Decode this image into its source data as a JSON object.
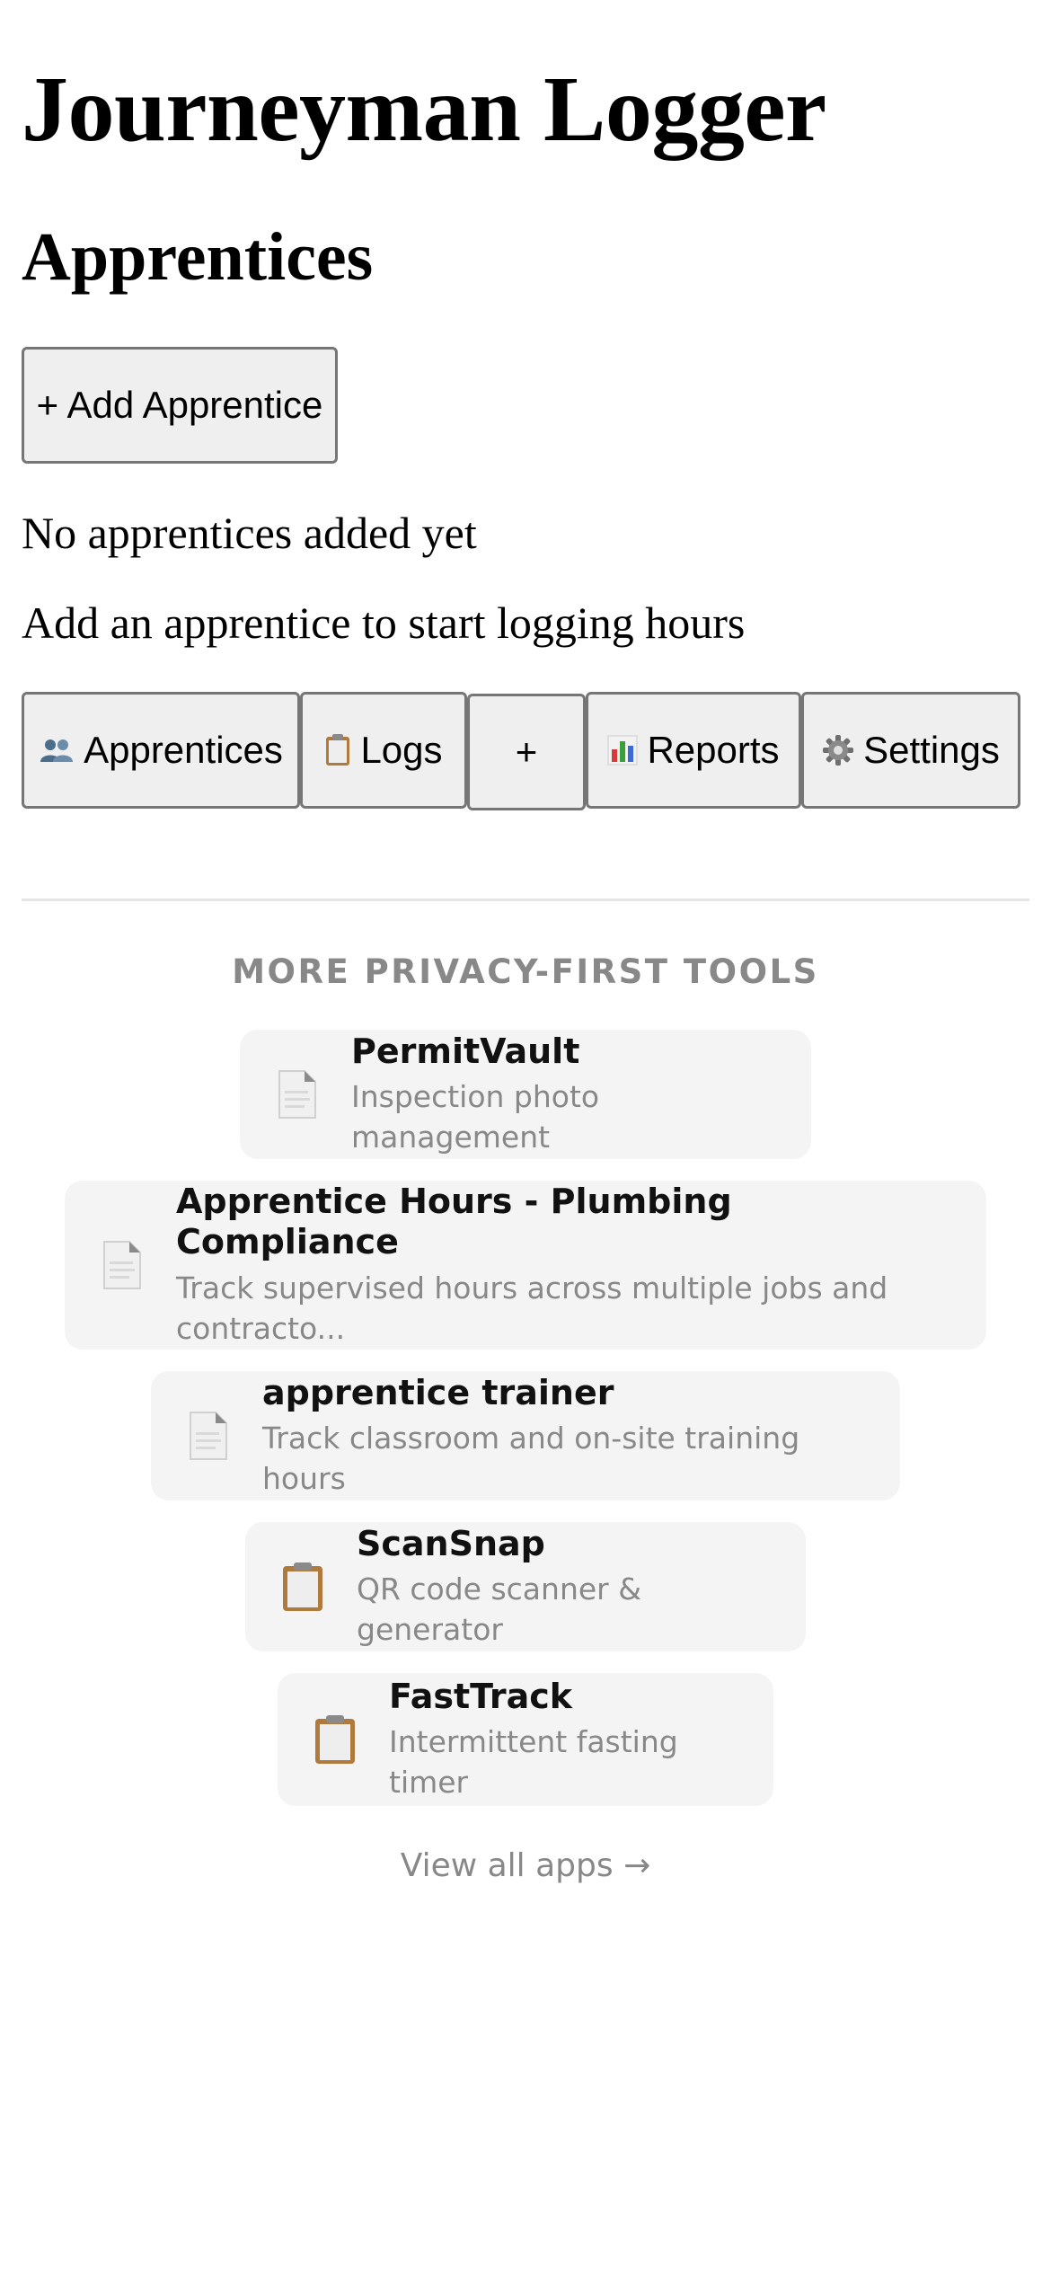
{
  "app": {
    "title": "Journeyman Logger"
  },
  "section": {
    "title": "Apprentices",
    "add_button": "+ Add Apprentice",
    "empty_title": "No apprentices added yet",
    "empty_hint": "Add an apprentice to start logging hours"
  },
  "nav": {
    "items": [
      {
        "label": "Apprentices",
        "icon": "people-icon"
      },
      {
        "label": "Logs",
        "icon": "clipboard-icon"
      },
      {
        "label": "+",
        "icon": ""
      },
      {
        "label": "Reports",
        "icon": "bar-chart-icon"
      },
      {
        "label": "Settings",
        "icon": "gear-icon"
      }
    ]
  },
  "promo": {
    "heading": "MORE PRIVACY-FIRST TOOLS",
    "apps": [
      {
        "name": "PermitVault",
        "description": "Inspection photo management",
        "icon": "document-icon"
      },
      {
        "name": "Apprentice Hours - Plumbing Compliance",
        "description": "Track supervised hours across multiple jobs and contracto...",
        "icon": "document-icon"
      },
      {
        "name": "apprentice trainer",
        "description": "Track classroom and on-site training hours",
        "icon": "document-icon"
      },
      {
        "name": "ScanSnap",
        "description": "QR code scanner & generator",
        "icon": "clipboard-icon"
      },
      {
        "name": "FastTrack",
        "description": "Intermittent fasting timer",
        "icon": "clipboard-icon"
      }
    ],
    "view_all": "View all apps →"
  },
  "colors": {
    "button_bg": "#efefef",
    "button_border": "#767676",
    "card_bg": "#f4f4f4",
    "muted_text": "#888888"
  }
}
